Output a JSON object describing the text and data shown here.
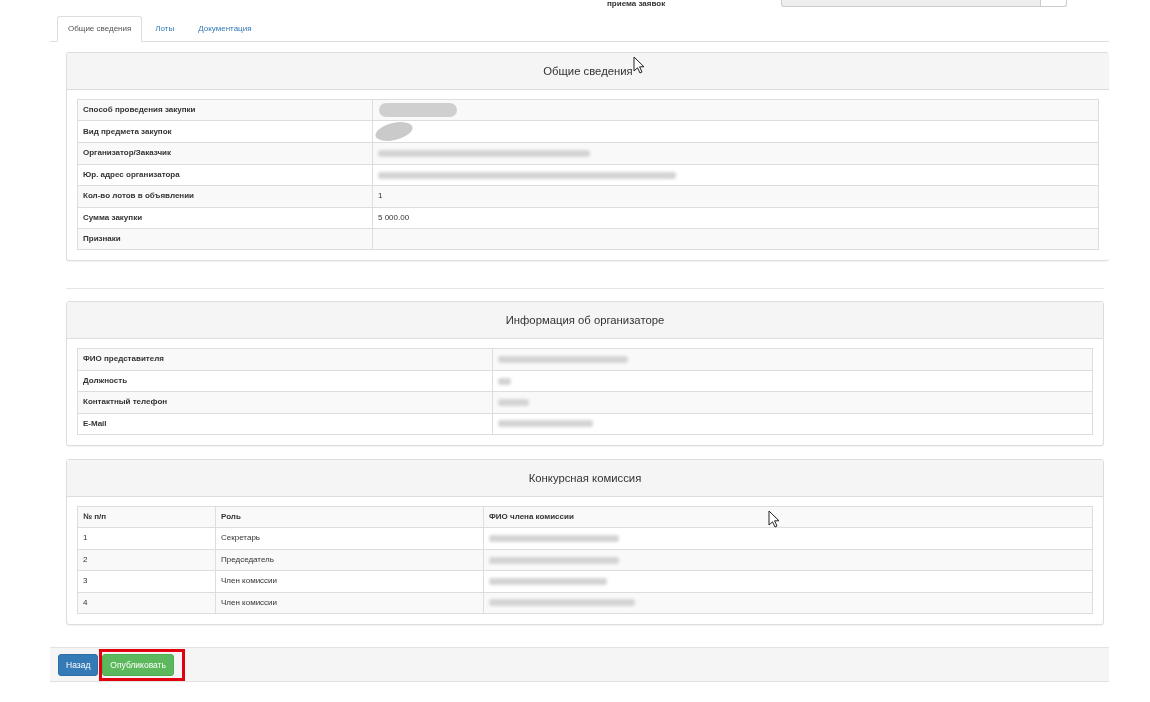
{
  "top_strip": {
    "label": "приема заявок"
  },
  "tabs": [
    {
      "label": "Общие сведения",
      "selected": true
    },
    {
      "label": "Лоты",
      "selected": false
    },
    {
      "label": "Документация",
      "selected": false
    }
  ],
  "general": {
    "title": "Общие сведения",
    "rows": [
      {
        "label": "Способ проведения закупки",
        "kind": "pill"
      },
      {
        "label": "Вид предмета закупок",
        "kind": "smudge"
      },
      {
        "label": "Организатор/Заказчик",
        "kind": "blur-wide"
      },
      {
        "label": "Юр. адрес организатора",
        "kind": "blur-widest"
      },
      {
        "label": "Кол-во лотов в объявлении",
        "kind": "text",
        "value": "1"
      },
      {
        "label": "Сумма закупки",
        "kind": "text",
        "value": "5 000.00"
      },
      {
        "label": "Признаки",
        "kind": "text"
      }
    ]
  },
  "organizer": {
    "title": "Информация об организаторе",
    "rows": [
      {
        "label": "ФИО представителя",
        "kind": "blur-longer"
      },
      {
        "label": "Должность",
        "kind": "blur-tiny"
      },
      {
        "label": "Контактный телефон",
        "kind": "blur-short"
      },
      {
        "label": "E-Mail",
        "kind": "blur-medium"
      }
    ]
  },
  "commission": {
    "title": "Конкурсная комиссия",
    "columns": [
      "№ п/п",
      "Роль",
      "ФИО члена комиссии"
    ],
    "rows": [
      {
        "number": "1",
        "role": "Секретарь",
        "member": {
          "kind": "blur-longer"
        }
      },
      {
        "number": "2",
        "role": "Председатель",
        "member": {
          "kind": "blur-longer"
        }
      },
      {
        "number": "3",
        "role": "Член комиссии",
        "member": {
          "kind": "blur-long"
        }
      },
      {
        "number": "4",
        "role": "Член комиссии",
        "member": {
          "kind": "blur-longest"
        }
      }
    ]
  },
  "buttons": [
    {
      "label": "Назад",
      "kind": "primary",
      "highlighted": false
    },
    {
      "label": "Опубликовать",
      "kind": "success",
      "highlighted": true
    }
  ]
}
